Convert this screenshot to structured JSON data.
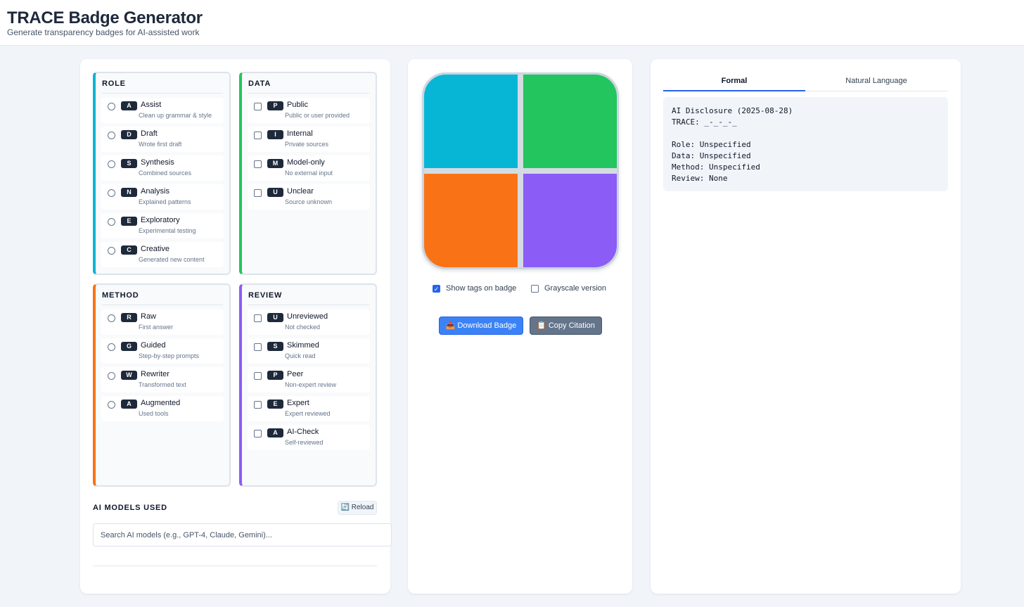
{
  "header": {
    "title": "TRACE Badge Generator",
    "subtitle": "Generate transparency badges for AI-assisted work"
  },
  "categories": {
    "role": {
      "title": "ROLE",
      "color": "#06b6d4",
      "options": [
        {
          "key": "A",
          "label": "Assist",
          "desc": "Clean up grammar & style"
        },
        {
          "key": "D",
          "label": "Draft",
          "desc": "Wrote first draft"
        },
        {
          "key": "S",
          "label": "Synthesis",
          "desc": "Combined sources"
        },
        {
          "key": "N",
          "label": "Analysis",
          "desc": "Explained patterns"
        },
        {
          "key": "E",
          "label": "Exploratory",
          "desc": "Experimental testing"
        },
        {
          "key": "C",
          "label": "Creative",
          "desc": "Generated new content"
        }
      ]
    },
    "data": {
      "title": "DATA",
      "color": "#22c55e",
      "options": [
        {
          "key": "P",
          "label": "Public",
          "desc": "Public or user provided"
        },
        {
          "key": "I",
          "label": "Internal",
          "desc": "Private sources"
        },
        {
          "key": "M",
          "label": "Model-only",
          "desc": "No external input"
        },
        {
          "key": "U",
          "label": "Unclear",
          "desc": "Source unknown"
        }
      ]
    },
    "method": {
      "title": "METHOD",
      "color": "#f97316",
      "options": [
        {
          "key": "R",
          "label": "Raw",
          "desc": "First answer"
        },
        {
          "key": "G",
          "label": "Guided",
          "desc": "Step-by-step prompts"
        },
        {
          "key": "W",
          "label": "Rewriter",
          "desc": "Transformed text"
        },
        {
          "key": "A",
          "label": "Augmented",
          "desc": "Used tools"
        }
      ]
    },
    "review": {
      "title": "REVIEW",
      "color": "#8b5cf6",
      "options": [
        {
          "key": "U",
          "label": "Unreviewed",
          "desc": "Not checked"
        },
        {
          "key": "S",
          "label": "Skimmed",
          "desc": "Quick read"
        },
        {
          "key": "P",
          "label": "Peer",
          "desc": "Non-expert review"
        },
        {
          "key": "E",
          "label": "Expert",
          "desc": "Expert reviewed"
        },
        {
          "key": "A",
          "label": "AI-Check",
          "desc": "Self-reviewed"
        }
      ]
    }
  },
  "models": {
    "title": "AI MODELS USED",
    "reload_label": "🔄 Reload",
    "search_placeholder": "Search AI models (e.g., GPT-4, Claude, Gemini)..."
  },
  "badge": {
    "quadrant_colors": [
      "#06b6d4",
      "#22c55e",
      "#f97316",
      "#8b5cf6"
    ],
    "show_tags_label": "Show tags on badge",
    "show_tags_checked": true,
    "grayscale_label": "Grayscale version",
    "grayscale_checked": false,
    "download_label": "📥 Download Badge",
    "copy_label": "📋 Copy Citation"
  },
  "citation": {
    "tabs": [
      "Formal",
      "Natural Language"
    ],
    "active_tab": "Formal",
    "lines": [
      "AI Disclosure (2025-08-28)",
      "TRACE: _-_-_-_",
      "",
      "Role: Unspecified",
      "Data: Unspecified",
      "Method: Unspecified",
      "Review: None"
    ]
  }
}
